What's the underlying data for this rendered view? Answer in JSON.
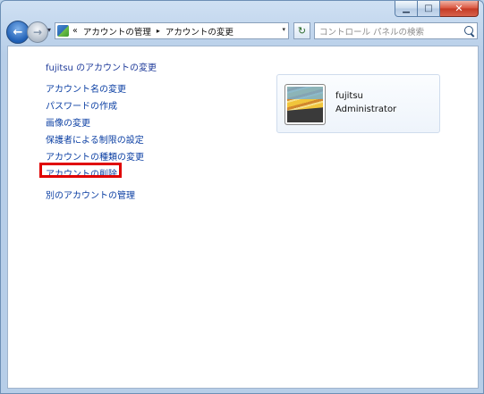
{
  "window": {
    "caption": {
      "minimize": "▁",
      "maximize": "□",
      "close": "✕"
    }
  },
  "nav": {
    "back_glyph": "←",
    "forward_glyph": "→",
    "history_glyph": "▾",
    "breadcrumb_prefix": "«",
    "breadcrumbs": [
      "アカウントの管理",
      "アカウントの変更"
    ],
    "separator": "▸",
    "dropdown_glyph": "▾",
    "refresh_glyph": "↻",
    "search_placeholder": "コントロール パネルの検索"
  },
  "content": {
    "title": "fujitsu のアカウントの変更",
    "links": [
      "アカウント名の変更",
      "パスワードの作成",
      "画像の変更",
      "保護者による制限の設定",
      "アカウントの種類の変更",
      "アカウントの削除",
      "別のアカウントの管理"
    ],
    "user": {
      "name": "fujitsu",
      "role": "Administrator"
    }
  },
  "colors": {
    "link": "#0b3fa3",
    "highlight": "#e00000"
  }
}
